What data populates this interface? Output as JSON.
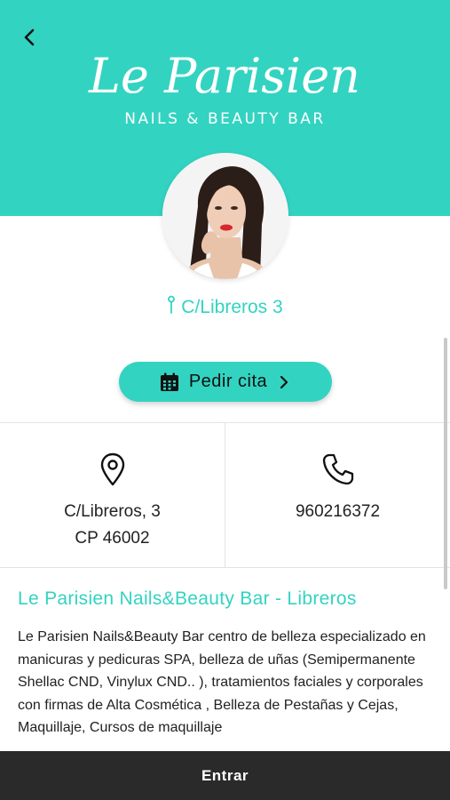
{
  "header": {
    "brand_script": "Le Parisien",
    "brand_subtitle": "NAILS & BEAUTY BAR",
    "back_icon": "chevron-left-icon",
    "background_color": "#33d3c1"
  },
  "salon": {
    "address_short": "C/Libreros 3",
    "address_icon": "map-pin-icon"
  },
  "booking": {
    "button_label": "Pedir cita",
    "calendar_icon": "calendar-icon",
    "arrow_icon": "chevron-right-icon"
  },
  "contact": {
    "location_icon": "location-pin-icon",
    "address_line1": "C/Libreros, 3",
    "address_line2": "CP 46002",
    "phone_icon": "phone-icon",
    "phone": "960216372"
  },
  "description": {
    "title": "Le Parisien Nails&Beauty Bar - Libreros",
    "text": "Le Parisien Nails&Beauty Bar centro de belleza especializado en manicuras y pedicuras SPA, belleza de uñas (Semipermanente Shellac CND, Vinylux CND.. ), tratamientos faciales y corporales con firmas de Alta Cosmética , Belleza de Pestañas y Cejas, Maquillaje, Cursos de maquillaje"
  },
  "footer": {
    "button_label": "Entrar"
  },
  "colors": {
    "accent": "#33d3c1",
    "footer": "#2a2a2a"
  }
}
